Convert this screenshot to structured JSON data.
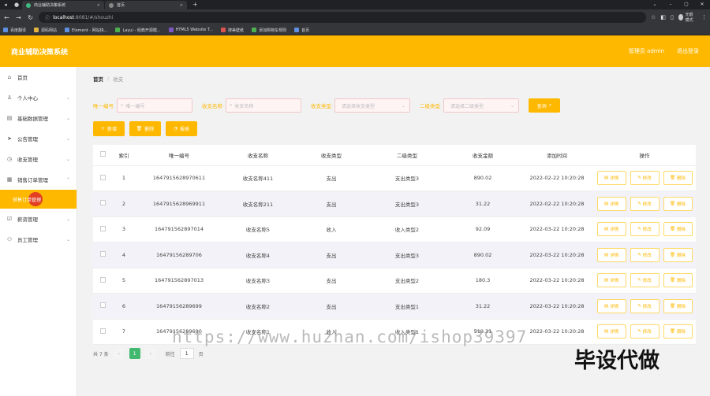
{
  "browser": {
    "tabs": [
      {
        "title": "商业辅助决策系统",
        "icon": "vue-logo-icon",
        "active": true
      },
      {
        "title": "首页",
        "icon": "globe-icon",
        "active": false
      }
    ],
    "url_host": "localhost",
    "url_path": ":8081/#/shouzhi",
    "profile_label": "无痕模式",
    "bookmarks": [
      {
        "label": "百度翻译",
        "icon": "bookmark-icon"
      },
      {
        "label": "源码网站",
        "icon": "bookmark-icon"
      },
      {
        "label": "Element - 网站快...",
        "icon": "element-icon"
      },
      {
        "label": "Layui - 经典开源模...",
        "icon": "layui-icon"
      },
      {
        "label": "HTML5 Website T...",
        "icon": "html5-icon"
      },
      {
        "label": "搜美壁纸",
        "icon": "bookmark-icon"
      },
      {
        "label": "添加购物车规则",
        "icon": "bookmark-icon"
      },
      {
        "label": "首页",
        "icon": "bookmark-icon"
      }
    ]
  },
  "header": {
    "title": "商业辅助决策系统",
    "admin_label": "管理员 admin",
    "logout_label": "退出登录",
    "color": "#ffb800"
  },
  "sidebar": {
    "items": [
      {
        "label": "首页",
        "icon": "home-icon",
        "has_arrow": false
      },
      {
        "label": "个人中心",
        "icon": "user-icon",
        "has_arrow": true
      },
      {
        "label": "基础数据管理",
        "icon": "database-icon",
        "has_arrow": true
      },
      {
        "label": "公告管理",
        "icon": "send-icon",
        "has_arrow": true
      },
      {
        "label": "收支管理",
        "icon": "clock-icon",
        "has_arrow": true
      },
      {
        "label": "销售订单管理",
        "icon": "grid-icon",
        "has_arrow": true
      }
    ],
    "active_sub": "销售订单管理",
    "items_after": [
      {
        "label": "薪资管理",
        "icon": "check-square-icon",
        "has_arrow": true
      },
      {
        "label": "员工管理",
        "icon": "users-icon",
        "has_arrow": true
      }
    ]
  },
  "breadcrumb": {
    "home": "首页",
    "separator": "/",
    "current": "收支"
  },
  "search": {
    "field1_label": "唯一编号",
    "field1_placeholder": "唯一编号",
    "field2_label": "收支名称",
    "field2_placeholder": "收支名称",
    "field3_label": "收支类型",
    "field3_placeholder": "请选择收支类型",
    "field4_label": "二级类型",
    "field4_placeholder": "请选择二级类型",
    "query_label": "查询"
  },
  "actions": {
    "add": "新增",
    "delete": "删除",
    "report": "报表"
  },
  "table": {
    "headers": [
      "索引",
      "唯一编号",
      "收支名称",
      "收支类型",
      "二级类型",
      "收支金额",
      "添加时间",
      "操作"
    ],
    "rows": [
      {
        "index": "1",
        "code": "1647915628970611",
        "name": "收支名称411",
        "type": "支出",
        "sub": "支出类型3",
        "amount": "890.02",
        "time": "2022-02-22 10:20:28"
      },
      {
        "index": "2",
        "code": "1647915628969911",
        "name": "收支名称211",
        "type": "支出",
        "sub": "支出类型3",
        "amount": "31.22",
        "time": "2022-02-22 10:20:28"
      },
      {
        "index": "3",
        "code": "164791562897014",
        "name": "收支名称5",
        "type": "收入",
        "sub": "收入类型2",
        "amount": "92.09",
        "time": "2022-03-22 10:20:28"
      },
      {
        "index": "4",
        "code": "16479156289706",
        "name": "收支名称4",
        "type": "支出",
        "sub": "支出类型3",
        "amount": "890.02",
        "time": "2022-03-22 10:20:28"
      },
      {
        "index": "5",
        "code": "164791562897013",
        "name": "收支名称3",
        "type": "支出",
        "sub": "支出类型2",
        "amount": "180.3",
        "time": "2022-03-22 10:20:28"
      },
      {
        "index": "6",
        "code": "16479156289699",
        "name": "收支名称2",
        "type": "支出",
        "sub": "支出类型1",
        "amount": "31.22",
        "time": "2022-03-22 10:20:28"
      },
      {
        "index": "7",
        "code": "16479156289690",
        "name": "收支名称1",
        "type": "收入",
        "sub": "收入类型1",
        "amount": "519.31",
        "time": "2022-03-22 10:20:28"
      }
    ],
    "op_detail": "详情",
    "op_edit": "修改",
    "op_delete": "删除"
  },
  "pagination": {
    "total": "共 7 条",
    "prev": "‹",
    "current": "1",
    "next": "›",
    "goto_label": "前往",
    "goto_value": "1",
    "page_suffix": "页"
  },
  "overlay": {
    "watermark": "https://www.huzhan.com/ishop39397",
    "stamp": "毕设代做"
  }
}
